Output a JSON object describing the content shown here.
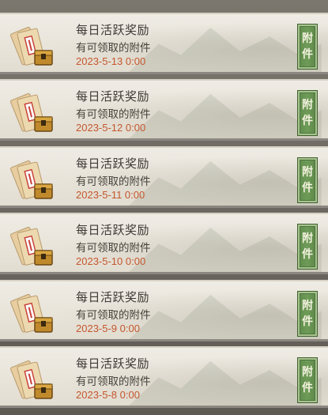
{
  "mails": [
    {
      "title": "每日活跃奖励",
      "subtitle": "有可领取的附件",
      "date": "2023-5-13 0:00",
      "badge": [
        "附",
        "件"
      ]
    },
    {
      "title": "每日活跃奖励",
      "subtitle": "有可领取的附件",
      "date": "2023-5-12 0:00",
      "badge": [
        "附",
        "件"
      ]
    },
    {
      "title": "每日活跃奖励",
      "subtitle": "有可领取的附件",
      "date": "2023-5-11 0:00",
      "badge": [
        "附",
        "件"
      ]
    },
    {
      "title": "每日活跃奖励",
      "subtitle": "有可领取的附件",
      "date": "2023-5-10 0:00",
      "badge": [
        "附",
        "件"
      ]
    },
    {
      "title": "每日活跃奖励",
      "subtitle": "有可领取的附件",
      "date": "2023-5-9 0:00",
      "badge": [
        "附",
        "件"
      ]
    },
    {
      "title": "每日活跃奖励",
      "subtitle": "有可领取的附件",
      "date": "2023-5-8 0:00",
      "badge": [
        "附",
        "件"
      ]
    }
  ],
  "colors": {
    "date": "#c4572e",
    "badge_green": "#6f9c58",
    "row_bg": "#e8e4da"
  },
  "icons": {
    "mail": "envelope-with-chest-icon"
  }
}
